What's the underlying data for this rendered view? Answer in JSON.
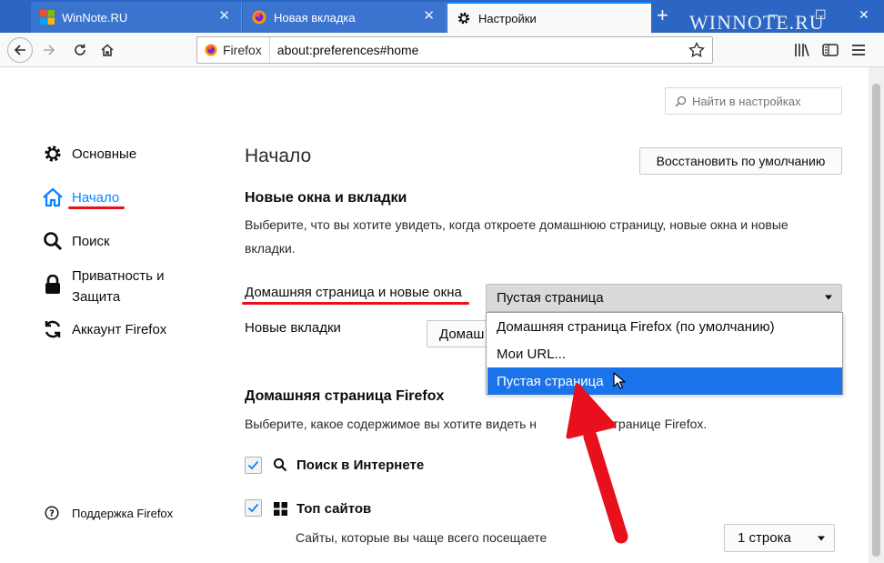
{
  "tabs": [
    {
      "title": "WinNote.RU",
      "favicon": "windows-logo-icon"
    },
    {
      "title": "Новая вкладка",
      "favicon": "firefox-icon"
    },
    {
      "title": "Настройки",
      "favicon": "gear-icon"
    }
  ],
  "watermark": "WINNOTE.RU",
  "urlbar": {
    "identity": "Firefox",
    "url": "about:preferences#home"
  },
  "search": {
    "placeholder": "Найти в настройках"
  },
  "sidebar": {
    "items": [
      {
        "label": "Основные",
        "icon": "gear-icon"
      },
      {
        "label": "Начало",
        "icon": "home-icon"
      },
      {
        "label": "Поиск",
        "icon": "search-icon"
      },
      {
        "label": "Приватность и Защита",
        "line1": "Приватность и",
        "line2": "Защита",
        "icon": "lock-icon"
      },
      {
        "label": "Аккаунт Firefox",
        "icon": "sync-icon"
      }
    ],
    "support": "Поддержка Firefox"
  },
  "main": {
    "title": "Начало",
    "restore_button": "Восстановить по умолчанию",
    "section1_heading": "Новые окна и вкладки",
    "section1_desc_line1": "Выберите, что вы хотите увидеть, когда откроете домашнюю страницу, новые окна и новые",
    "section1_desc_line2": "вкладки.",
    "homepage_label": "Домашняя страница и новые окна",
    "homepage_value": "Пустая страница",
    "newtabs_label": "Новые вкладки",
    "newtabs_value": "Домашняя страница Firefox",
    "newtabs_visible_value": "Домаш",
    "dropdown_options": [
      "Домашняя страница Firefox (по умолчанию)",
      "Мои URL...",
      "Пустая страница"
    ],
    "dropdown_selected_index": 2,
    "section2_heading": "Домашняя страница Firefox",
    "section2_desc_visible": "Выберите, какое содержимое вы хотите видеть н",
    "section2_desc_after": "шней странице Firefox.",
    "websearch_label": "Поиск в Интернете",
    "websearch_checked": true,
    "topsites_label": "Топ сайтов",
    "topsites_checked": true,
    "topsites_desc": "Сайты, которые вы чаще всего посещаете",
    "topsites_rows": "1 строка"
  },
  "colors": {
    "accent": "#0a84ff",
    "annotation": "#e8101c",
    "tabstrip": "#2b66c4"
  }
}
